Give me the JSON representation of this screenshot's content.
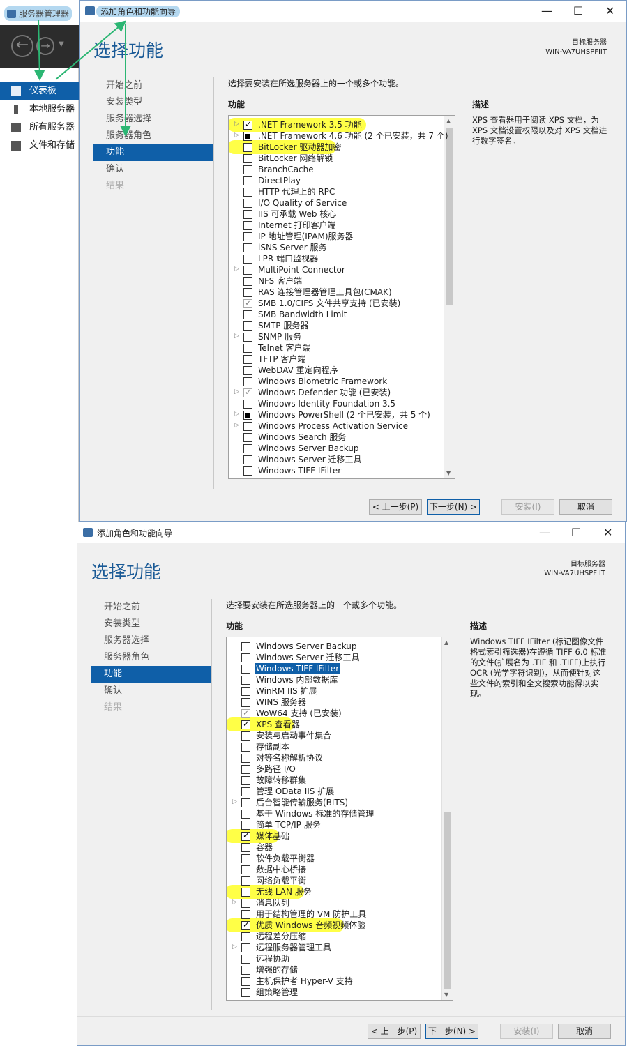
{
  "server_manager": {
    "title": "服务器管理器",
    "sidebar": [
      {
        "label": "仪表板",
        "active": true
      },
      {
        "label": "本地服务器",
        "active": false
      },
      {
        "label": "所有服务器",
        "active": false
      },
      {
        "label": "文件和存储",
        "active": false
      }
    ]
  },
  "wizard": {
    "window_title": "添加角色和功能向导",
    "page_title": "选择功能",
    "dest_label": "目标服务器",
    "dest_server": "WIN-VA7UHSPFIIT",
    "steps": [
      {
        "label": "开始之前",
        "state": "normal"
      },
      {
        "label": "安装类型",
        "state": "normal"
      },
      {
        "label": "服务器选择",
        "state": "normal"
      },
      {
        "label": "服务器角色",
        "state": "normal"
      },
      {
        "label": "功能",
        "state": "active"
      },
      {
        "label": "确认",
        "state": "normal"
      },
      {
        "label": "结果",
        "state": "disabled"
      }
    ],
    "instruction": "选择要安装在所选服务器上的一个或多个功能。",
    "features_label": "功能",
    "description_label": "描述",
    "buttons": {
      "prev": "< 上一步(P)",
      "next": "下一步(N) >",
      "install": "安装(I)",
      "cancel": "取消"
    }
  },
  "panel1": {
    "description": "XPS 查看器用于阅读 XPS 文档，为 XPS 文档设置权限以及对 XPS 文档进行数字签名。",
    "features": [
      {
        "label": ".NET Framework 3.5 功能",
        "state": "checked",
        "expand": true,
        "highlight": true
      },
      {
        "label": ".NET Framework 4.6 功能 (2 个已安装，共 7 个)",
        "state": "partial",
        "expand": true
      },
      {
        "label": "BitLocker 驱动器加密",
        "state": "unchecked",
        "highlight": true
      },
      {
        "label": "BitLocker 网络解锁",
        "state": "unchecked"
      },
      {
        "label": "BranchCache",
        "state": "unchecked"
      },
      {
        "label": "DirectPlay",
        "state": "unchecked"
      },
      {
        "label": "HTTP 代理上的 RPC",
        "state": "unchecked"
      },
      {
        "label": "I/O Quality of Service",
        "state": "unchecked"
      },
      {
        "label": "IIS 可承载 Web 核心",
        "state": "unchecked"
      },
      {
        "label": "Internet 打印客户端",
        "state": "unchecked"
      },
      {
        "label": "IP 地址管理(IPAM)服务器",
        "state": "unchecked"
      },
      {
        "label": "iSNS Server 服务",
        "state": "unchecked"
      },
      {
        "label": "LPR 端口监视器",
        "state": "unchecked"
      },
      {
        "label": "MultiPoint Connector",
        "state": "unchecked",
        "expand": true
      },
      {
        "label": "NFS 客户端",
        "state": "unchecked"
      },
      {
        "label": "RAS 连接管理器管理工具包(CMAK)",
        "state": "unchecked"
      },
      {
        "label": "SMB 1.0/CIFS 文件共享支持 (已安装)",
        "state": "installed"
      },
      {
        "label": "SMB Bandwidth Limit",
        "state": "unchecked"
      },
      {
        "label": "SMTP 服务器",
        "state": "unchecked"
      },
      {
        "label": "SNMP 服务",
        "state": "unchecked",
        "expand": true
      },
      {
        "label": "Telnet 客户端",
        "state": "unchecked"
      },
      {
        "label": "TFTP 客户端",
        "state": "unchecked"
      },
      {
        "label": "WebDAV 重定向程序",
        "state": "unchecked"
      },
      {
        "label": "Windows Biometric Framework",
        "state": "unchecked"
      },
      {
        "label": "Windows Defender 功能 (已安装)",
        "state": "installed",
        "expand": true
      },
      {
        "label": "Windows Identity Foundation 3.5",
        "state": "unchecked"
      },
      {
        "label": "Windows PowerShell (2 个已安装，共 5 个)",
        "state": "partial",
        "expand": true
      },
      {
        "label": "Windows Process Activation Service",
        "state": "unchecked",
        "expand": true
      },
      {
        "label": "Windows Search 服务",
        "state": "unchecked"
      },
      {
        "label": "Windows Server Backup",
        "state": "unchecked"
      },
      {
        "label": "Windows Server 迁移工具",
        "state": "unchecked"
      },
      {
        "label": "Windows TIFF IFilter",
        "state": "unchecked"
      }
    ]
  },
  "panel2": {
    "description": "Windows TIFF IFilter (标记图像文件格式索引筛选器)在遵循 TIFF 6.0 标准的文件(扩展名为 .TIF 和 .TIFF)上执行 OCR (光学字符识别)，从而使针对这些文件的索引和全文搜索功能得以实现。",
    "features": [
      {
        "label": "Windows Server Backup",
        "state": "unchecked"
      },
      {
        "label": "Windows Server 迁移工具",
        "state": "unchecked"
      },
      {
        "label": "Windows TIFF IFilter",
        "state": "unchecked",
        "selected": true
      },
      {
        "label": "Windows 内部数据库",
        "state": "unchecked"
      },
      {
        "label": "WinRM IIS 扩展",
        "state": "unchecked"
      },
      {
        "label": "WINS 服务器",
        "state": "unchecked"
      },
      {
        "label": "WoW64 支持 (已安装)",
        "state": "installed"
      },
      {
        "label": "XPS 查看器",
        "state": "checked",
        "highlight": true
      },
      {
        "label": "安装与启动事件集合",
        "state": "unchecked"
      },
      {
        "label": "存储副本",
        "state": "unchecked"
      },
      {
        "label": "对等名称解析协议",
        "state": "unchecked"
      },
      {
        "label": "多路径 I/O",
        "state": "unchecked"
      },
      {
        "label": "故障转移群集",
        "state": "unchecked"
      },
      {
        "label": "管理 OData IIS 扩展",
        "state": "unchecked"
      },
      {
        "label": "后台智能传输服务(BITS)",
        "state": "unchecked",
        "expand": true
      },
      {
        "label": "基于 Windows 标准的存储管理",
        "state": "unchecked"
      },
      {
        "label": "简单 TCP/IP 服务",
        "state": "unchecked"
      },
      {
        "label": "媒体基础",
        "state": "checked",
        "highlight": true
      },
      {
        "label": "容器",
        "state": "unchecked"
      },
      {
        "label": "软件负载平衡器",
        "state": "unchecked"
      },
      {
        "label": "数据中心桥接",
        "state": "unchecked"
      },
      {
        "label": "网络负载平衡",
        "state": "unchecked"
      },
      {
        "label": "无线 LAN 服务",
        "state": "unchecked",
        "highlight": true
      },
      {
        "label": "消息队列",
        "state": "unchecked",
        "expand": true
      },
      {
        "label": "用于结构管理的 VM 防护工具",
        "state": "unchecked"
      },
      {
        "label": "优质 Windows 音频视频体验",
        "state": "checked",
        "highlight": true
      },
      {
        "label": "远程差分压缩",
        "state": "unchecked"
      },
      {
        "label": "远程服务器管理工具",
        "state": "unchecked",
        "expand": true
      },
      {
        "label": "远程协助",
        "state": "unchecked"
      },
      {
        "label": "增强的存储",
        "state": "unchecked"
      },
      {
        "label": "主机保护者 Hyper-V 支持",
        "state": "unchecked"
      },
      {
        "label": "组策略管理",
        "state": "unchecked"
      }
    ]
  },
  "colors": {
    "accent": "#0f5fa8",
    "highlight": "#ffff33",
    "arrow": "#2bb673"
  }
}
